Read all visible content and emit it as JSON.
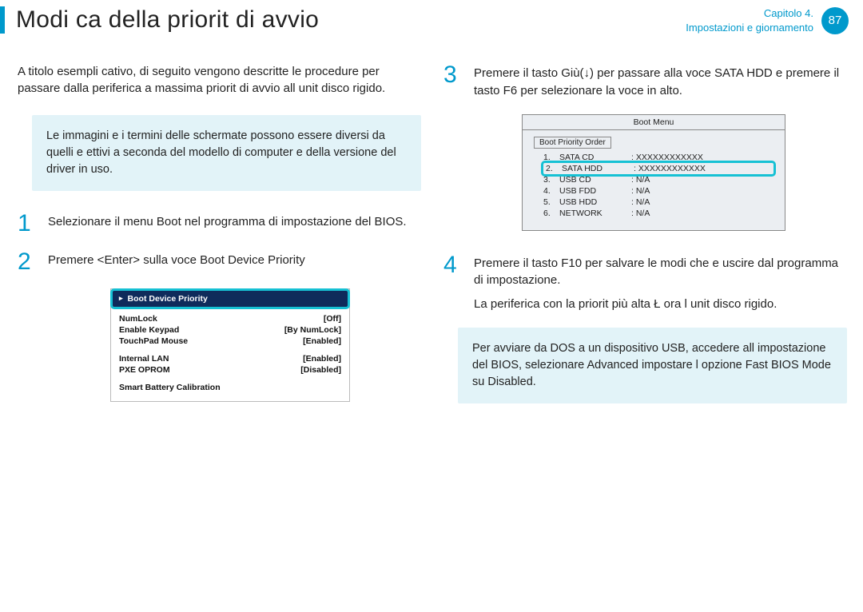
{
  "header": {
    "title": "Modi ca della priorit  di avvio",
    "chapter_line1": "Capitolo 4.",
    "chapter_line2": "Impostazioni e giornamento",
    "page_number": "87"
  },
  "left": {
    "intro": "A titolo esempli cativo, di seguito vengono descritte le procedure per passare dalla periferica a massima priorit  di avvio all unit  disco rigido.",
    "note": "Le immagini e i termini delle schermate possono essere diversi da quelli e ettivi a seconda del modello di computer e della versione del driver in uso.",
    "step1": {
      "num": "1",
      "text": "Selezionare il menu Boot nel programma di impostazione del BIOS."
    },
    "step2": {
      "num": "2",
      "text": "Premere <Enter> sulla voce Boot Device Priority"
    }
  },
  "bios1": {
    "header": "Boot Device Priority",
    "rows": [
      {
        "k": "NumLock",
        "v": "[Off]"
      },
      {
        "k": "Enable Keypad",
        "v": "[By NumLock]"
      },
      {
        "k": "TouchPad Mouse",
        "v": "[Enabled]"
      }
    ],
    "rows2": [
      {
        "k": "Internal LAN",
        "v": "[Enabled]"
      },
      {
        "k": "PXE OPROM",
        "v": "[Disabled]"
      }
    ],
    "rows3": [
      {
        "k": "Smart Battery Calibration",
        "v": ""
      }
    ]
  },
  "right": {
    "step3": {
      "num": "3",
      "text": "Premere il tasto Giù(↓) per passare alla voce SATA HDD e premere il tasto F6 per selezionare la voce in alto."
    },
    "step4": {
      "num": "4",
      "text": "Premere il tasto F10 per salvare le modi che e uscire dal programma di impostazione.",
      "cont": "La periferica con la priorit  più alta Ł ora l unit  disco rigido."
    },
    "note2": "Per avviare da DOS a un dispositivo USB, accedere all impostazione del BIOS, selezionare Advanced impostare l opzione Fast BIOS Mode su Disabled."
  },
  "bios2": {
    "title": "Boot Menu",
    "label": "Boot Priority Order",
    "rows": [
      {
        "idx": "1.",
        "dev": "SATA CD",
        "val": ":   XXXXXXXXXXXX"
      },
      {
        "idx": "2.",
        "dev": "SATA HDD",
        "val": ":   XXXXXXXXXXXX",
        "hl": true
      },
      {
        "idx": "3.",
        "dev": "USB CD",
        "val": ":   N/A"
      },
      {
        "idx": "4.",
        "dev": "USB FDD",
        "val": ":   N/A"
      },
      {
        "idx": "5.",
        "dev": "USB HDD",
        "val": ":   N/A"
      },
      {
        "idx": "6.",
        "dev": "NETWORK",
        "val": ":   N/A"
      }
    ]
  }
}
